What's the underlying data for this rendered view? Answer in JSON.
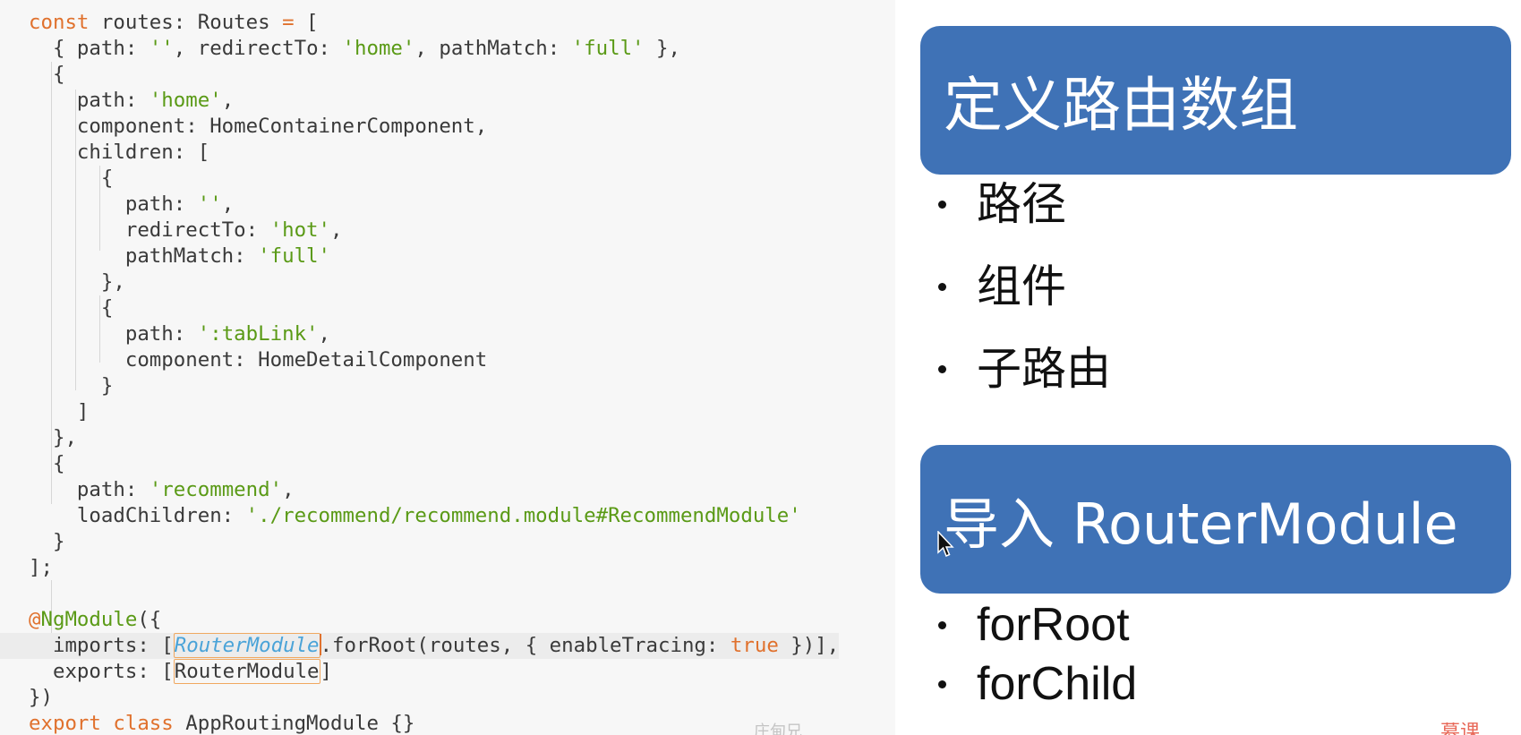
{
  "code": {
    "lines": [
      [
        {
          "t": "const",
          "c": "kw"
        },
        {
          "t": " routes: Routes "
        },
        {
          "t": "=",
          "c": "kw"
        },
        {
          "t": " ["
        }
      ],
      [
        {
          "t": "  { path: "
        },
        {
          "t": "''",
          "c": "str"
        },
        {
          "t": ", redirectTo: "
        },
        {
          "t": "'home'",
          "c": "str"
        },
        {
          "t": ", pathMatch: "
        },
        {
          "t": "'full'",
          "c": "str"
        },
        {
          "t": " },"
        }
      ],
      [
        {
          "t": "  {"
        }
      ],
      [
        {
          "t": "    path: "
        },
        {
          "t": "'home'",
          "c": "str"
        },
        {
          "t": ","
        }
      ],
      [
        {
          "t": "    component: HomeContainerComponent,"
        }
      ],
      [
        {
          "t": "    children: ["
        }
      ],
      [
        {
          "t": "      {"
        }
      ],
      [
        {
          "t": "        path: "
        },
        {
          "t": "''",
          "c": "str"
        },
        {
          "t": ","
        }
      ],
      [
        {
          "t": "        redirectTo: "
        },
        {
          "t": "'hot'",
          "c": "str"
        },
        {
          "t": ","
        }
      ],
      [
        {
          "t": "        pathMatch: "
        },
        {
          "t": "'full'",
          "c": "str"
        }
      ],
      [
        {
          "t": "      },"
        }
      ],
      [
        {
          "t": "      {"
        }
      ],
      [
        {
          "t": "        path: "
        },
        {
          "t": "':tabLink'",
          "c": "str"
        },
        {
          "t": ","
        }
      ],
      [
        {
          "t": "        component: HomeDetailComponent"
        }
      ],
      [
        {
          "t": "      }"
        }
      ],
      [
        {
          "t": "    ]"
        }
      ],
      [
        {
          "t": "  },"
        }
      ],
      [
        {
          "t": "  {"
        }
      ],
      [
        {
          "t": "    path: "
        },
        {
          "t": "'recommend'",
          "c": "str"
        },
        {
          "t": ","
        }
      ],
      [
        {
          "t": "    loadChildren: "
        },
        {
          "t": "'./recommend/recommend.module#RecommendModule'",
          "c": "str"
        }
      ],
      [
        {
          "t": "  }"
        }
      ],
      [
        {
          "t": "];"
        }
      ],
      [
        {
          "t": ""
        }
      ],
      [
        {
          "t": "@",
          "c": "at"
        },
        {
          "t": "NgModule",
          "c": "str"
        },
        {
          "t": "({"
        }
      ],
      [
        {
          "t": "  imports: ["
        },
        {
          "t": "RouterModule",
          "c": "sel-a"
        },
        {
          "t": "",
          "c": "cursor"
        },
        {
          "t": ".forRoot(routes, { enableTracing: "
        },
        {
          "t": "true",
          "c": "boolv"
        },
        {
          "t": " })],"
        }
      ],
      [
        {
          "t": "  exports: ["
        },
        {
          "t": "RouterModule",
          "c": "sel-b"
        },
        {
          "t": "]"
        }
      ],
      [
        {
          "t": "})"
        }
      ],
      [
        {
          "t": "export class",
          "c": "kw"
        },
        {
          "t": " "
        },
        {
          "t": "AppRoutingModule",
          "c": "str2"
        },
        {
          "t": " {}"
        }
      ]
    ],
    "highlight_line": 24,
    "footer_mark": "庄甸兄"
  },
  "slide": {
    "heading_1": "定义路由数组",
    "bullets_1": [
      "路径",
      "组件",
      "子路由"
    ],
    "heading_2": "导入 RouterModule",
    "bullets_2": [
      "forRoot",
      "forChild"
    ],
    "logo_text": "慕课"
  },
  "colors": {
    "banner": "#3f72b6",
    "keyword": "#e0712d",
    "string": "#5a9a16",
    "selection_border": "#f0a860"
  }
}
